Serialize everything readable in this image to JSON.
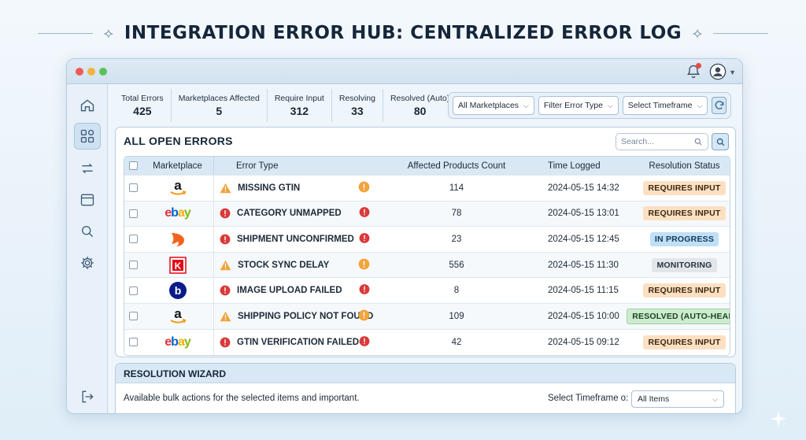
{
  "page_title": "INTEGRATION ERROR HUB: CENTRALIZED ERROR LOG",
  "stats": [
    {
      "label": "Total Errors",
      "value": "425"
    },
    {
      "label": "Marketplaces Affected",
      "value": "5"
    },
    {
      "label": "Require Input",
      "value": "312"
    },
    {
      "label": "Resolving",
      "value": "33"
    },
    {
      "label": "Resolved (Auto)",
      "value": "80"
    }
  ],
  "filters": {
    "marketplace": "All Marketplaces",
    "error_type": "Filter Error Type",
    "timeframe": "Select Timeframe"
  },
  "panel": {
    "title": "ALL OPEN ERRORS",
    "search_placeholder": "Search..."
  },
  "table": {
    "headers": {
      "marketplace": "Marketplace",
      "error_type": "Error Type",
      "affected": "Affected Products Count",
      "time": "Time Logged",
      "status": "Resolution Status"
    },
    "rows": [
      {
        "marketplace": "amazon",
        "severity": "warning",
        "error": "MISSING GTIN",
        "count": "114",
        "time": "2024-05-15 14:32",
        "status": "REQUIRES INPUT",
        "status_kind": "requires"
      },
      {
        "marketplace": "ebay",
        "severity": "error",
        "error": "CATEGORY UNMAPPED",
        "count": "78",
        "time": "2024-05-15 13:01",
        "status": "REQUIRES INPUT",
        "status_kind": "requires"
      },
      {
        "marketplace": "orange-flame",
        "severity": "error",
        "error": "SHIPMENT UNCONFIRMED",
        "count": "23",
        "time": "2024-05-15 12:45",
        "status": "IN PROGRESS",
        "status_kind": "progress"
      },
      {
        "marketplace": "kaufland",
        "severity": "warning",
        "error": "STOCK SYNC DELAY",
        "count": "556",
        "time": "2024-05-15 11:30",
        "status": "MONITORING",
        "status_kind": "monitoring"
      },
      {
        "marketplace": "bol",
        "severity": "error",
        "error": "IMAGE UPLOAD FAILED",
        "count": "8",
        "time": "2024-05-15 11:15",
        "status": "REQUIRES INPUT",
        "status_kind": "requires"
      },
      {
        "marketplace": "amazon",
        "severity": "warning",
        "error": "SHIPPING POLICY NOT FOUND",
        "count": "109",
        "time": "2024-05-15 10:00",
        "status": "RESOLVED (AUTO-HEAL)",
        "status_kind": "resolved"
      },
      {
        "marketplace": "ebay",
        "severity": "error",
        "error": "GTIN VERIFICATION FAILED",
        "count": "42",
        "time": "2024-05-15 09:12",
        "status": "REQUIRES INPUT",
        "status_kind": "requires"
      }
    ]
  },
  "wizard": {
    "title": "RESOLUTION WIZARD",
    "description": "Available bulk actions for the selected items and important.",
    "select_label": "Select Timeframe o:",
    "select_value": "All Items"
  },
  "logo_text": {
    "amazon": "a",
    "ebay": "ebay",
    "kaufland": "K",
    "bol": "b"
  },
  "colors": {
    "warning": "#f2a33a",
    "error": "#d93a3a",
    "accent": "#3f7fb6"
  }
}
